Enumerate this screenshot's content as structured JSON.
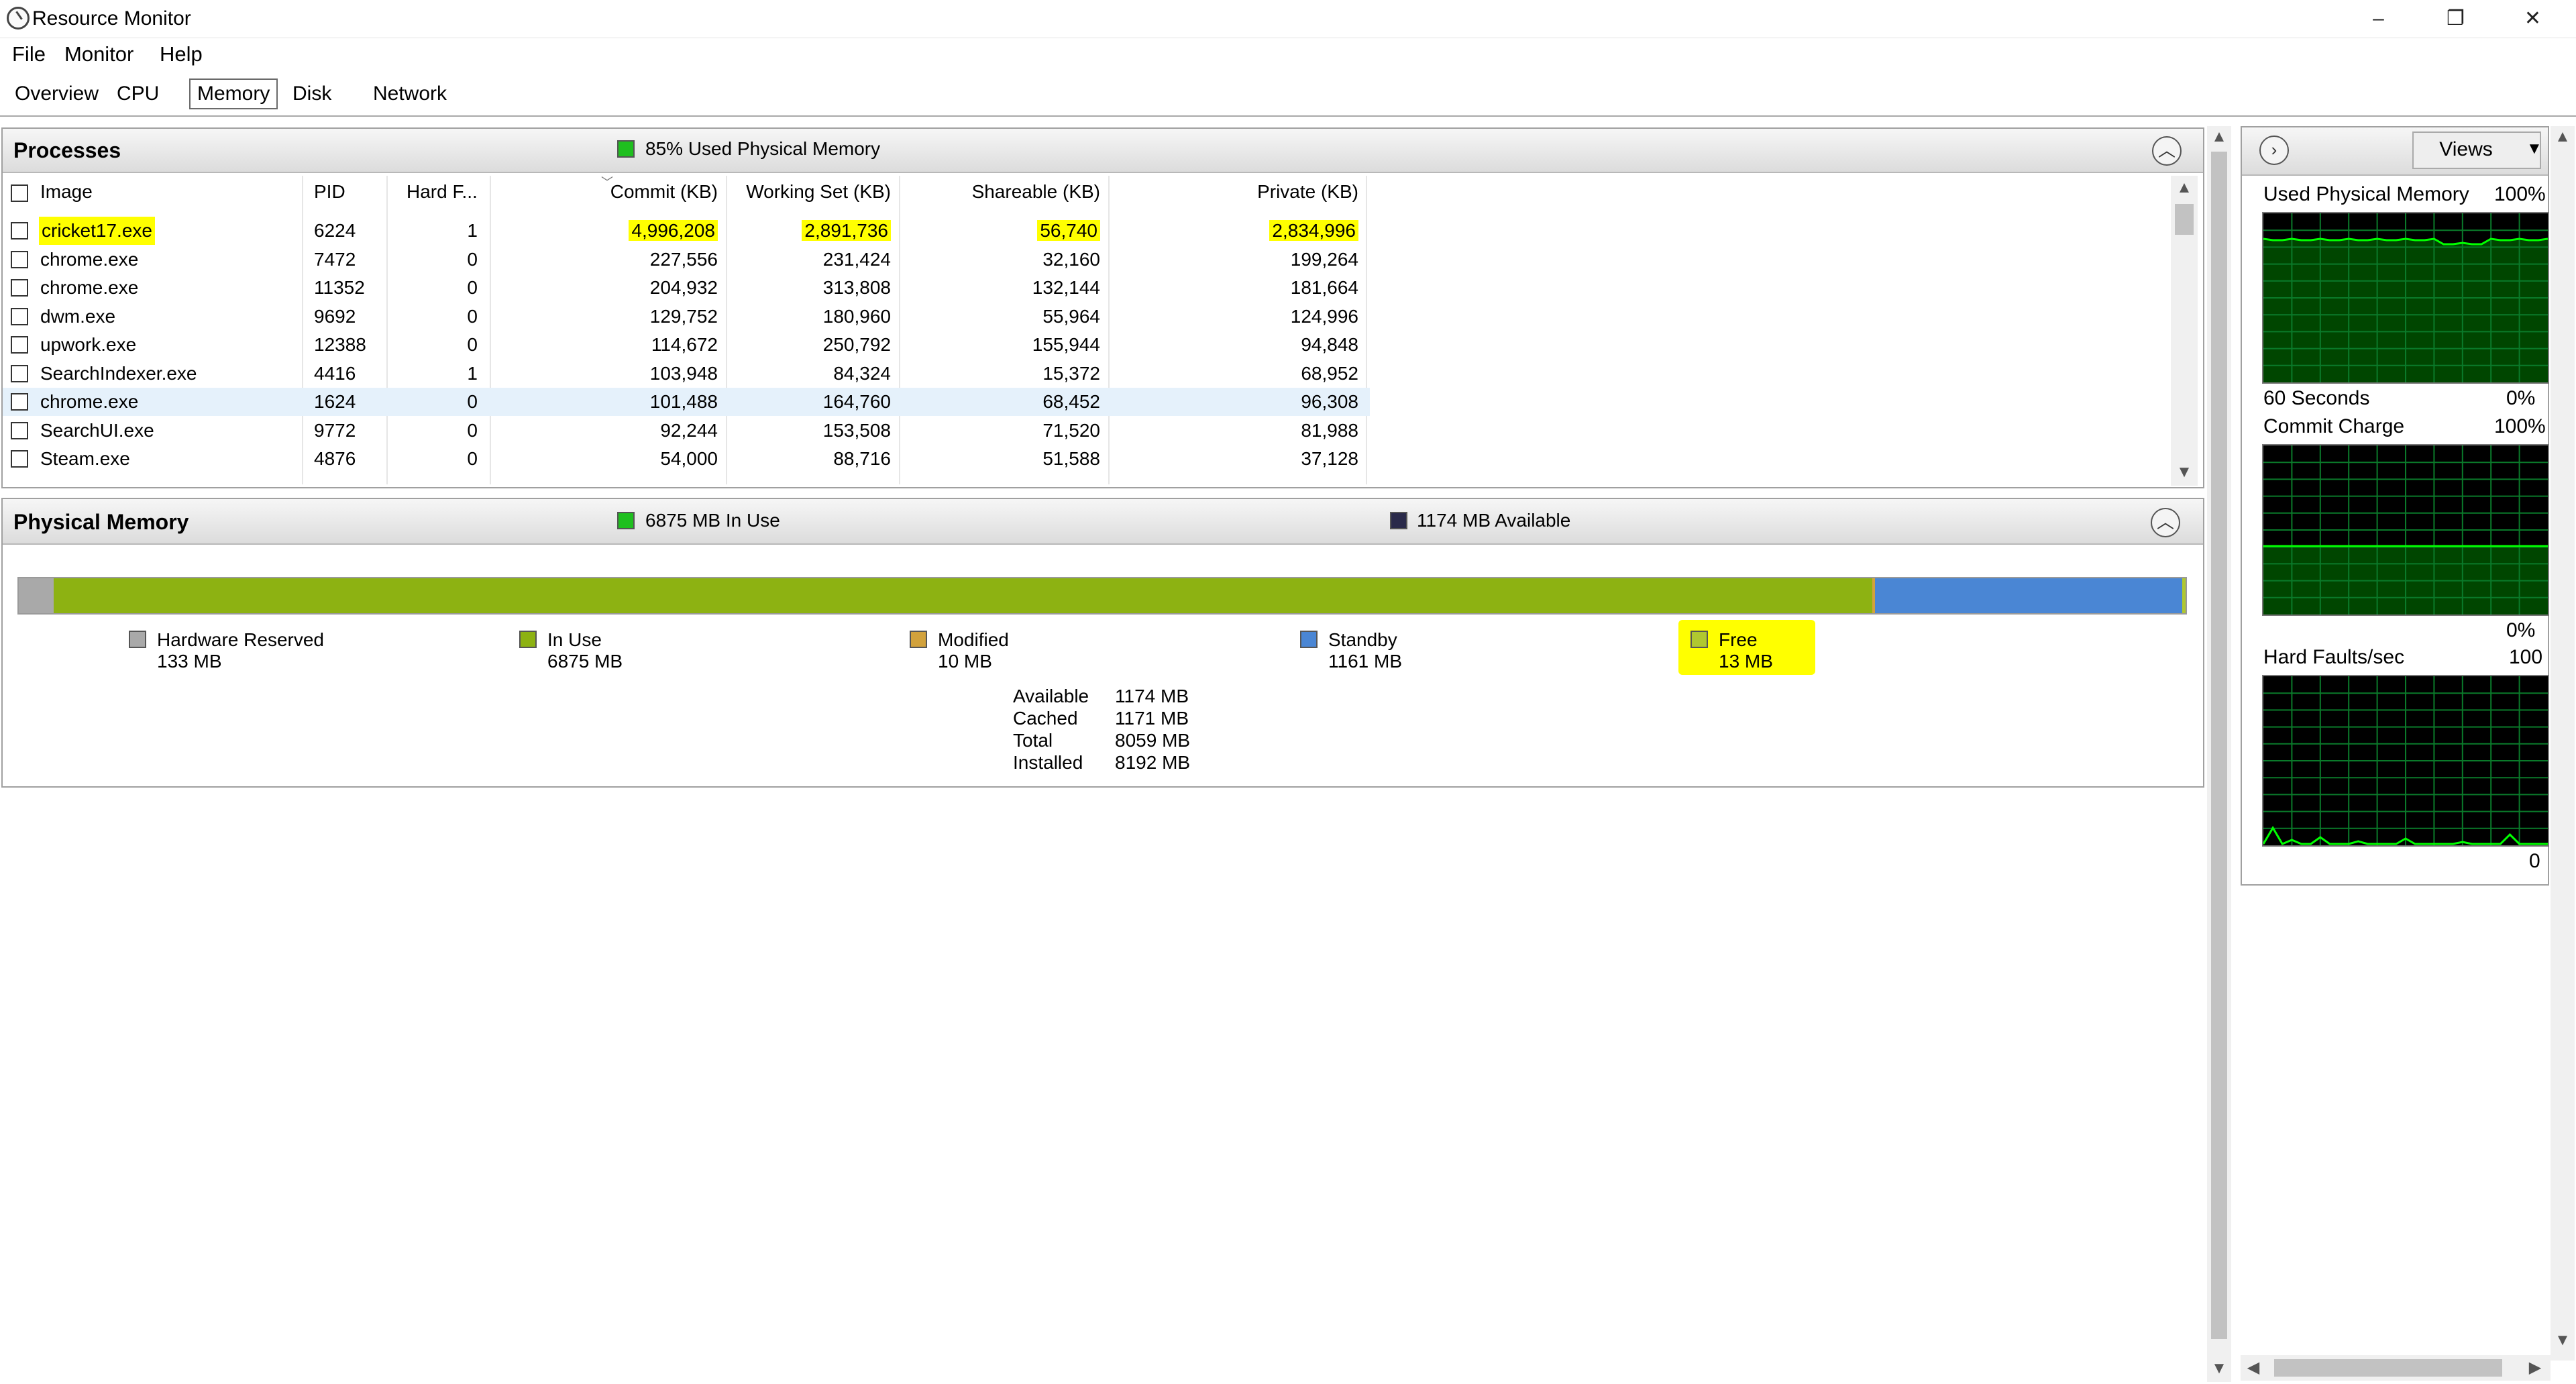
{
  "window": {
    "title": "Resource Monitor",
    "minimize": "–",
    "maximize": "❐",
    "close": "✕"
  },
  "menu": [
    "File",
    "Monitor",
    "Help"
  ],
  "tabs": [
    "Overview",
    "CPU",
    "Memory",
    "Disk",
    "Network"
  ],
  "active_tab": "Memory",
  "processes": {
    "title": "Processes",
    "status": "85% Used Physical Memory",
    "status_color": "#1fbf1f",
    "columns": [
      "Image",
      "PID",
      "Hard F...",
      "Commit (KB)",
      "Working Set (KB)",
      "Shareable (KB)",
      "Private (KB)"
    ],
    "rows": [
      {
        "image": "cricket17.exe",
        "pid": "6224",
        "hard": "1",
        "commit": "4,996,208",
        "working": "2,891,736",
        "shareable": "56,740",
        "private": "2,834,996"
      },
      {
        "image": "chrome.exe",
        "pid": "7472",
        "hard": "0",
        "commit": "227,556",
        "working": "231,424",
        "shareable": "32,160",
        "private": "199,264"
      },
      {
        "image": "chrome.exe",
        "pid": "11352",
        "hard": "0",
        "commit": "204,932",
        "working": "313,808",
        "shareable": "132,144",
        "private": "181,664"
      },
      {
        "image": "dwm.exe",
        "pid": "9692",
        "hard": "0",
        "commit": "129,752",
        "working": "180,960",
        "shareable": "55,964",
        "private": "124,996"
      },
      {
        "image": "upwork.exe",
        "pid": "12388",
        "hard": "0",
        "commit": "114,672",
        "working": "250,792",
        "shareable": "155,944",
        "private": "94,848"
      },
      {
        "image": "SearchIndexer.exe",
        "pid": "4416",
        "hard": "1",
        "commit": "103,948",
        "working": "84,324",
        "shareable": "15,372",
        "private": "68,952"
      },
      {
        "image": "chrome.exe",
        "pid": "1624",
        "hard": "0",
        "commit": "101,488",
        "working": "164,760",
        "shareable": "68,452",
        "private": "96,308"
      },
      {
        "image": "SearchUI.exe",
        "pid": "9772",
        "hard": "0",
        "commit": "92,244",
        "working": "153,508",
        "shareable": "71,520",
        "private": "81,988"
      },
      {
        "image": "Steam.exe",
        "pid": "4876",
        "hard": "0",
        "commit": "54,000",
        "working": "88,716",
        "shareable": "51,588",
        "private": "37,128"
      }
    ]
  },
  "physical_memory": {
    "title": "Physical Memory",
    "in_use_label": "6875 MB In Use",
    "available_label": "1174 MB Available",
    "in_use_color": "#1fbf1f",
    "available_color": "#2a2a4a",
    "legend": [
      {
        "name": "Hardware Reserved",
        "value": "133 MB",
        "color": "#a9a9a9"
      },
      {
        "name": "In Use",
        "value": "6875 MB",
        "color": "#8db212"
      },
      {
        "name": "Modified",
        "value": "10 MB",
        "color": "#d2a23c"
      },
      {
        "name": "Standby",
        "value": "1161 MB",
        "color": "#4a86d4"
      },
      {
        "name": "Free",
        "value": "13 MB",
        "color": "#b0c830"
      }
    ],
    "bar_mb": {
      "hardware_reserved": 133,
      "in_use": 6875,
      "modified": 10,
      "standby": 1161,
      "free": 13
    },
    "stats": [
      {
        "label": "Available",
        "value": "1174 MB"
      },
      {
        "label": "Cached",
        "value": "1171 MB"
      },
      {
        "label": "Total",
        "value": "8059 MB"
      },
      {
        "label": "Installed",
        "value": "8192 MB"
      }
    ]
  },
  "side": {
    "views_label": "Views",
    "graph1": {
      "title": "Used Physical Memory",
      "max": "100%",
      "time": "60 Seconds",
      "min": "0%"
    },
    "graph2": {
      "title": "Commit Charge",
      "max": "100%",
      "min": "0%"
    },
    "graph3": {
      "title": "Hard Faults/sec",
      "max": "100",
      "min": "0"
    }
  },
  "colors": {
    "highlight": "#ffff00",
    "selected_row": "#e5f1fb",
    "graph_line": "#00ff00",
    "graph_grid": "#0a7a2a"
  }
}
